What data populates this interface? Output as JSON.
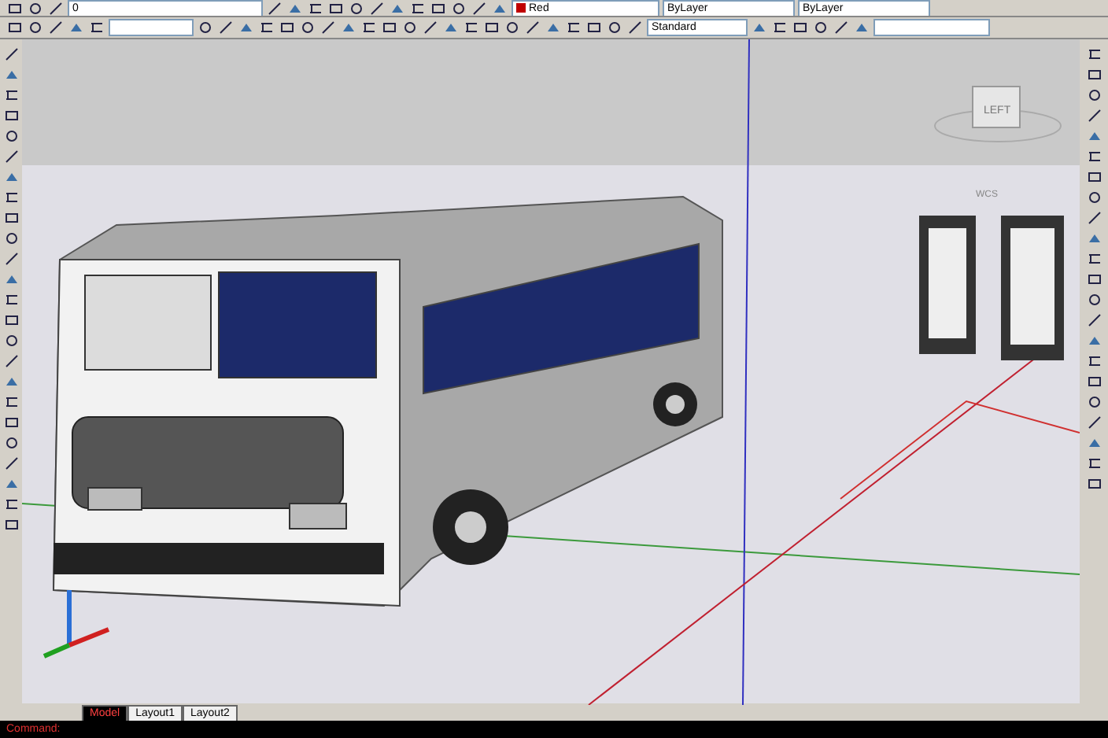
{
  "toolbar_top": {
    "layer": "0",
    "color_name": "Red",
    "linetype": "ByLayer",
    "lineweight": "ByLayer"
  },
  "toolbar_dim": {
    "style": "Standard"
  },
  "viewport": {
    "viewcube_face": "LEFT",
    "ucs_label": "WCS"
  },
  "layout_tabs": [
    {
      "label": "Model",
      "selected": true
    },
    {
      "label": "Layout1",
      "selected": false
    },
    {
      "label": "Layout2",
      "selected": false
    }
  ],
  "command_line": "Command:"
}
